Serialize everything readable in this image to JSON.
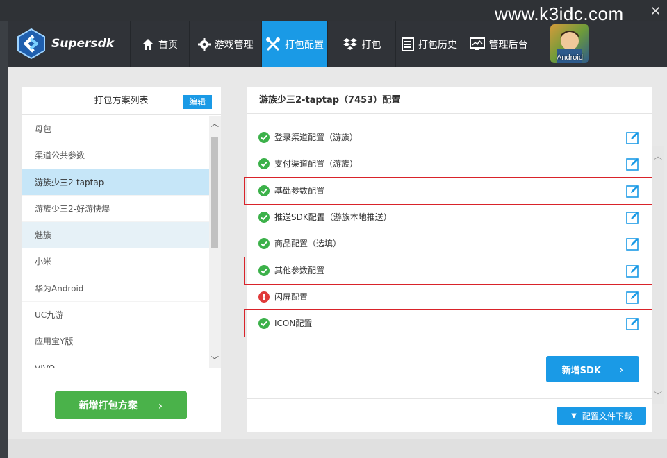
{
  "watermark": "www.k3idc.com",
  "app": {
    "logo_text": "Supersdk"
  },
  "nav": {
    "items": [
      {
        "label": "首页",
        "icon": "home-icon"
      },
      {
        "label": "游戏管理",
        "icon": "gear-icon"
      },
      {
        "label": "打包配置",
        "icon": "tools-icon",
        "active": true
      },
      {
        "label": "打包",
        "icon": "dropbox-icon"
      },
      {
        "label": "打包历史",
        "icon": "history-icon"
      },
      {
        "label": "管理后台",
        "icon": "monitor-icon"
      }
    ],
    "avatar_label": "Android"
  },
  "left": {
    "title": "打包方案列表",
    "edit_label": "编辑",
    "items": [
      {
        "label": "母包"
      },
      {
        "label": "渠道公共参数"
      },
      {
        "label": "游族少三2-taptap",
        "selected": true
      },
      {
        "label": "游族少三2-好游快爆"
      },
      {
        "label": "魅族"
      },
      {
        "label": "小米"
      },
      {
        "label": "华为Android"
      },
      {
        "label": "UC九游"
      },
      {
        "label": "应用宝Y版"
      },
      {
        "label": "VIVO"
      }
    ],
    "new_plan_label": "新增打包方案"
  },
  "right": {
    "title": "游族少三2-taptap（7453）配置",
    "configs": [
      {
        "label": "登录渠道配置（游族）",
        "status": "ok"
      },
      {
        "label": "支付渠道配置（游族）",
        "status": "ok"
      },
      {
        "label": "基础参数配置",
        "status": "ok",
        "highlighted": true
      },
      {
        "label": "推送SDK配置（游族本地推送）",
        "status": "ok"
      },
      {
        "label": "商品配置（选填）",
        "status": "ok"
      },
      {
        "label": "其他参数配置",
        "status": "ok",
        "highlighted": true
      },
      {
        "label": "闪屏配置",
        "status": "error"
      },
      {
        "label": "ICON配置",
        "status": "ok",
        "highlighted": true
      }
    ],
    "new_sdk_label": "新增SDK",
    "download_label": "配置文件下载"
  },
  "colors": {
    "accent": "#1a9ae6",
    "nav_bg": "#303338",
    "success": "#3cb14a",
    "error": "#e03b3b",
    "highlight": "#d9232a",
    "green_button": "#4ab24a"
  }
}
